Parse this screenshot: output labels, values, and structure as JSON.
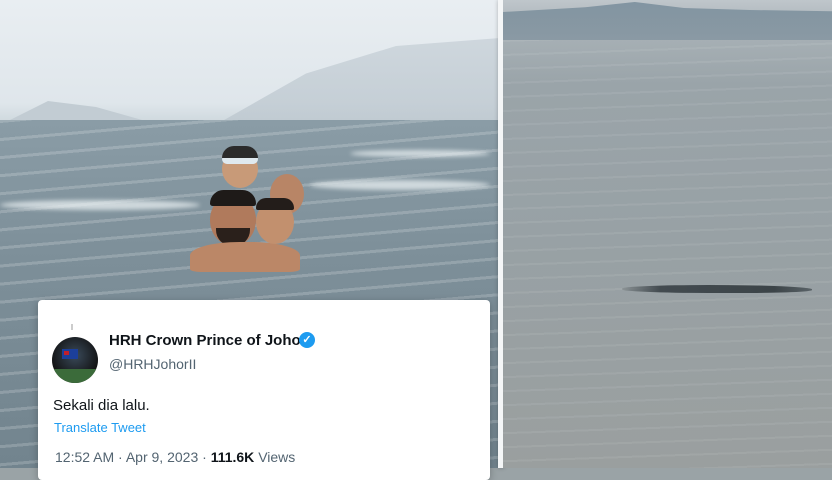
{
  "tweet": {
    "display_name": "HRH Crown Prince of Johor",
    "handle": "@HRHJohorII",
    "text": "Sekali dia lalu.",
    "translate_label": "Translate Tweet",
    "time": "12:52 AM",
    "separator": "·",
    "date": "Apr 9, 2023",
    "views_count": "111.6K",
    "views_label": "Views",
    "verified_glyph": "✓"
  },
  "icons": {
    "verified": "verified-badge-icon"
  },
  "colors": {
    "link": "#1d9bf0",
    "verified": "#1d9bf0",
    "text_primary": "#0f1419",
    "text_secondary": "#536471"
  }
}
